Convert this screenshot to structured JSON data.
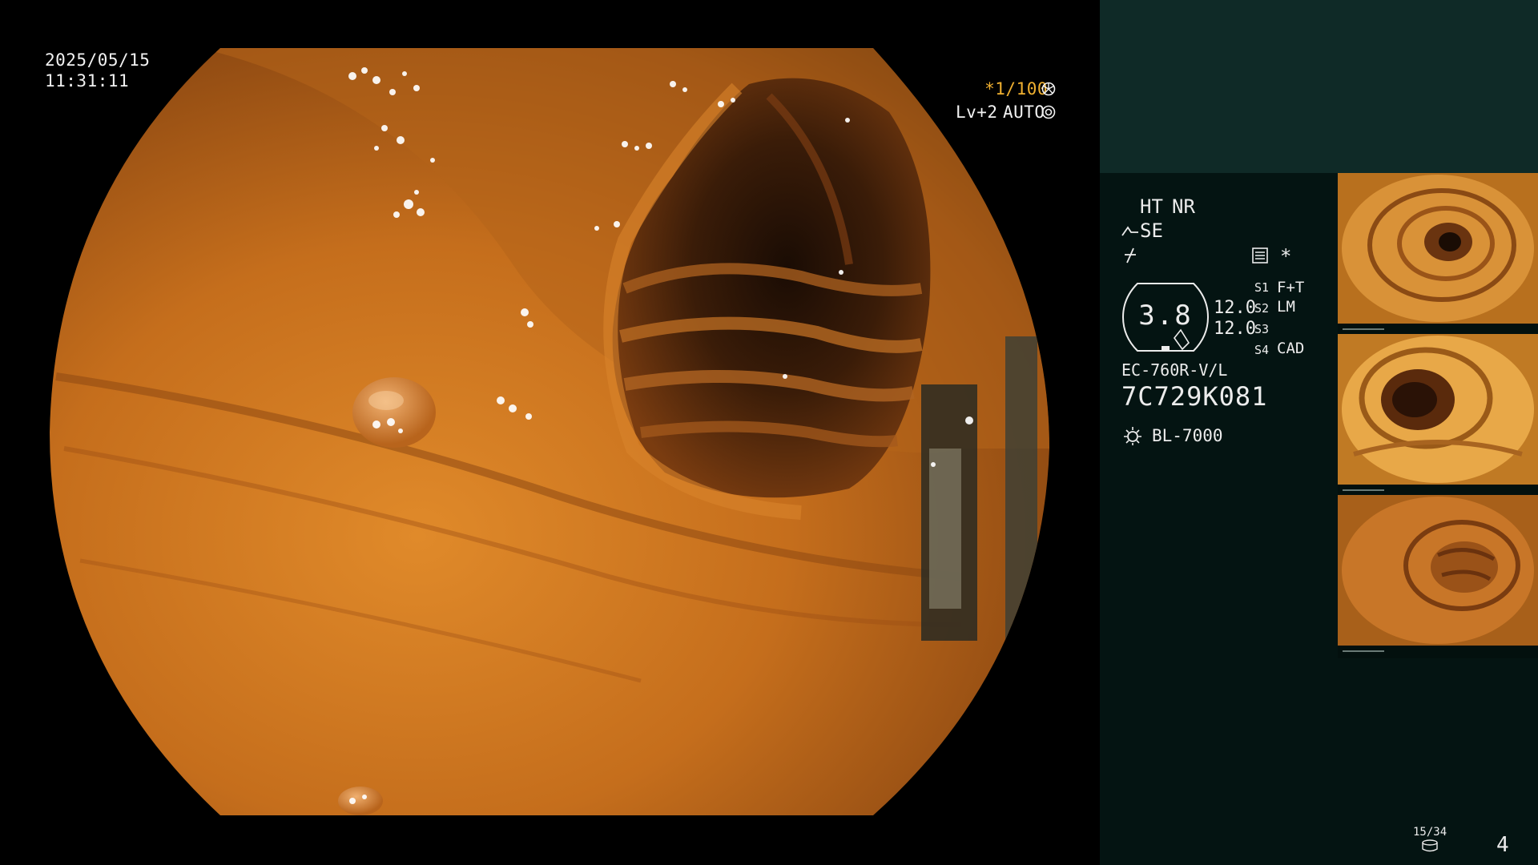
{
  "main_view": {
    "date": "2025/05/15",
    "time": "11:31:11",
    "shutter": "*1/100",
    "shutter_icon": "aperture-icon",
    "level": "Lv+2",
    "auto": "AUTO",
    "auto_icon": "iris-icon"
  },
  "side_panel": {
    "mode_ht": "HT",
    "mode_nr": "NR",
    "mode_se": "SE",
    "se_icon": "scope-tip-icon",
    "flash_icon": "flash-off-icon",
    "record_icon": "record-list-icon",
    "asterisk": "*",
    "gauge_value": "3.8",
    "readings": [
      "12.0",
      "12.0"
    ],
    "switches": [
      {
        "key": "S1",
        "value": "F+T"
      },
      {
        "key": "S2",
        "value": "LM"
      },
      {
        "key": "S3",
        "value": ""
      },
      {
        "key": "S4",
        "value": "CAD"
      }
    ],
    "scope_model": "EC-760R-V/L",
    "serial": "7C729K081",
    "light_icon": "light-source-icon",
    "light_source": "BL-7000",
    "thumbnails": [
      "thumbnail-1",
      "thumbnail-2",
      "thumbnail-3"
    ],
    "counter": "15/34",
    "counter_icon": "storage-icon",
    "page_number": "4"
  },
  "colors": {
    "mucosa": "#c8741c",
    "panel_dark": "#041412",
    "panel_top": "#0f2a27",
    "accent": "#f0b030"
  }
}
